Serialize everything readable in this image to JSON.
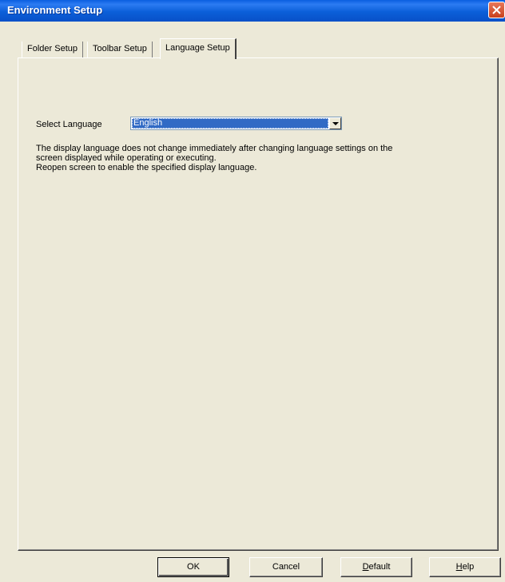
{
  "window": {
    "title": "Environment Setup"
  },
  "tabs": [
    {
      "label": "Folder Setup",
      "active": false
    },
    {
      "label": "Toolbar Setup",
      "active": false
    },
    {
      "label": "Language Setup",
      "active": true
    }
  ],
  "language": {
    "label": "Select Language",
    "selected": "English"
  },
  "description": [
    "The display language does not change immediately after changing language settings on the",
    "screen displayed while operating or executing.",
    "Reopen screen to enable the specified display language."
  ],
  "buttons": {
    "ok": "OK",
    "cancel": "Cancel",
    "default_rest": "efault",
    "default_mnemonic": "D",
    "help_rest": "elp",
    "help_mnemonic": "H"
  },
  "colors": {
    "titlebar": "#0a5ee0",
    "dialog_bg": "#ece9d8",
    "selection": "#316ac5"
  },
  "icons": {
    "close": "close-icon",
    "dropdown": "chevron-down-icon"
  }
}
